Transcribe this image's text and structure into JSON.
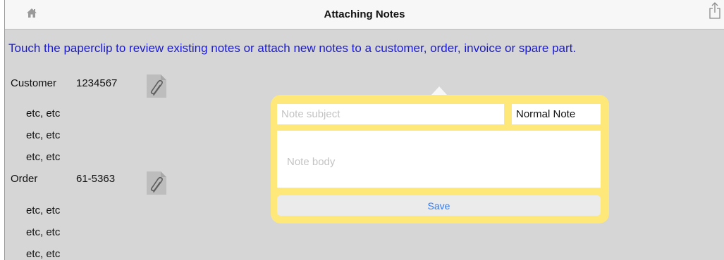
{
  "header": {
    "title": "Attaching Notes",
    "home_icon": "home-icon",
    "share_icon": "share-icon"
  },
  "instructions": "Touch the paperclip to review existing notes or attach new notes to a customer, order, invoice or spare part.",
  "customer": {
    "label": "Customer",
    "value": "1234567",
    "attach_icon": "paperclip-icon",
    "details": [
      "etc, etc",
      "etc, etc",
      "etc, etc"
    ]
  },
  "order": {
    "label": "Order",
    "value": "61-5363",
    "attach_icon": "paperclip-icon",
    "details": [
      "etc, etc",
      "etc, etc",
      "etc, etc"
    ]
  },
  "note_popover": {
    "subject_placeholder": "Note subject",
    "subject_value": "",
    "note_type": "Normal Note",
    "body_placeholder": "Note body",
    "body_value": "",
    "save_label": "Save"
  },
  "colors": {
    "instruction_text": "#1a1ad6",
    "popover_background": "#ffe87a",
    "save_text": "#2f7bf5",
    "page_background": "#d6d6d6"
  }
}
